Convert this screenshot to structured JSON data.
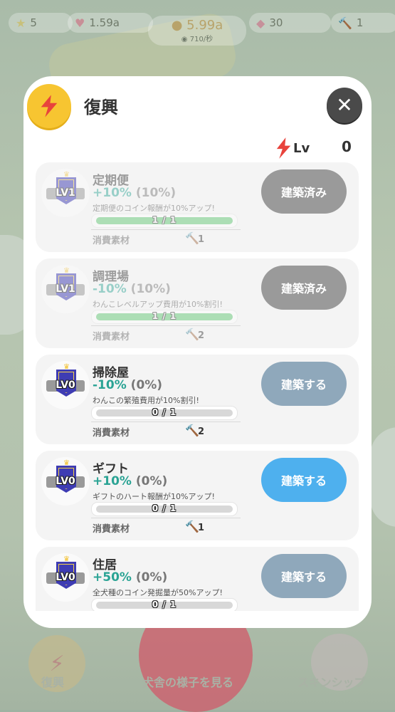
{
  "hud": {
    "stars": "5",
    "hearts": "1.59a",
    "coins": "5.99a",
    "coin_rate": "710/秒",
    "gems": "30",
    "hammers": "1"
  },
  "modal": {
    "title": "復興",
    "lv_label": "Lv",
    "lv_value": "0"
  },
  "material_label": "消費素材",
  "buildings": [
    {
      "level": "LV1",
      "name": "定期便",
      "effect_pct": "+10%",
      "effect_current": "(10%)",
      "description": "定期便のコイン報酬が10%アップ!",
      "progress_text": "1 / 1",
      "progress": 1.0,
      "material_count": "1",
      "button_label": "建築済み",
      "state": "built",
      "button_color": "#9a9a9a"
    },
    {
      "level": "LV1",
      "name": "調理場",
      "effect_pct": "-10%",
      "effect_current": "(10%)",
      "description": "わんこレベルアップ費用が10%割引!",
      "progress_text": "1 / 1",
      "progress": 1.0,
      "material_count": "2",
      "button_label": "建築済み",
      "state": "built",
      "button_color": "#9a9a9a"
    },
    {
      "level": "LV0",
      "name": "掃除屋",
      "effect_pct": "-10%",
      "effect_current": "(0%)",
      "description": "わんこの繁殖費用が10%割引!",
      "progress_text": "0 / 1",
      "progress": 0.0,
      "material_count": "2",
      "button_label": "建築する",
      "state": "locked",
      "button_color": "#8fa8bb"
    },
    {
      "level": "LV0",
      "name": "ギフト",
      "effect_pct": "+10%",
      "effect_current": "(0%)",
      "description": "ギフトのハート報酬が10%アップ!",
      "progress_text": "0 / 1",
      "progress": 0.0,
      "material_count": "1",
      "button_label": "建築する",
      "state": "available",
      "button_color": "#4eb0ee"
    },
    {
      "level": "LV0",
      "name": "住居",
      "effect_pct": "+50%",
      "effect_current": "(0%)",
      "description": "全犬種のコイン発掘量が50%アップ!",
      "progress_text": "0 / 1",
      "progress": 0.0,
      "material_count": "",
      "button_label": "建築する",
      "state": "locked",
      "button_color": "#8fa8bb"
    }
  ],
  "bottom_nav": {
    "left_label": "復興",
    "center_label": "犬舎の様子を見る",
    "right_label": "スキンシップ"
  },
  "colors": {
    "accent_yellow": "#f7c531",
    "effect_green": "#2aa394",
    "progress_green": "#57c46b",
    "build_blue": "#4eb0ee"
  }
}
